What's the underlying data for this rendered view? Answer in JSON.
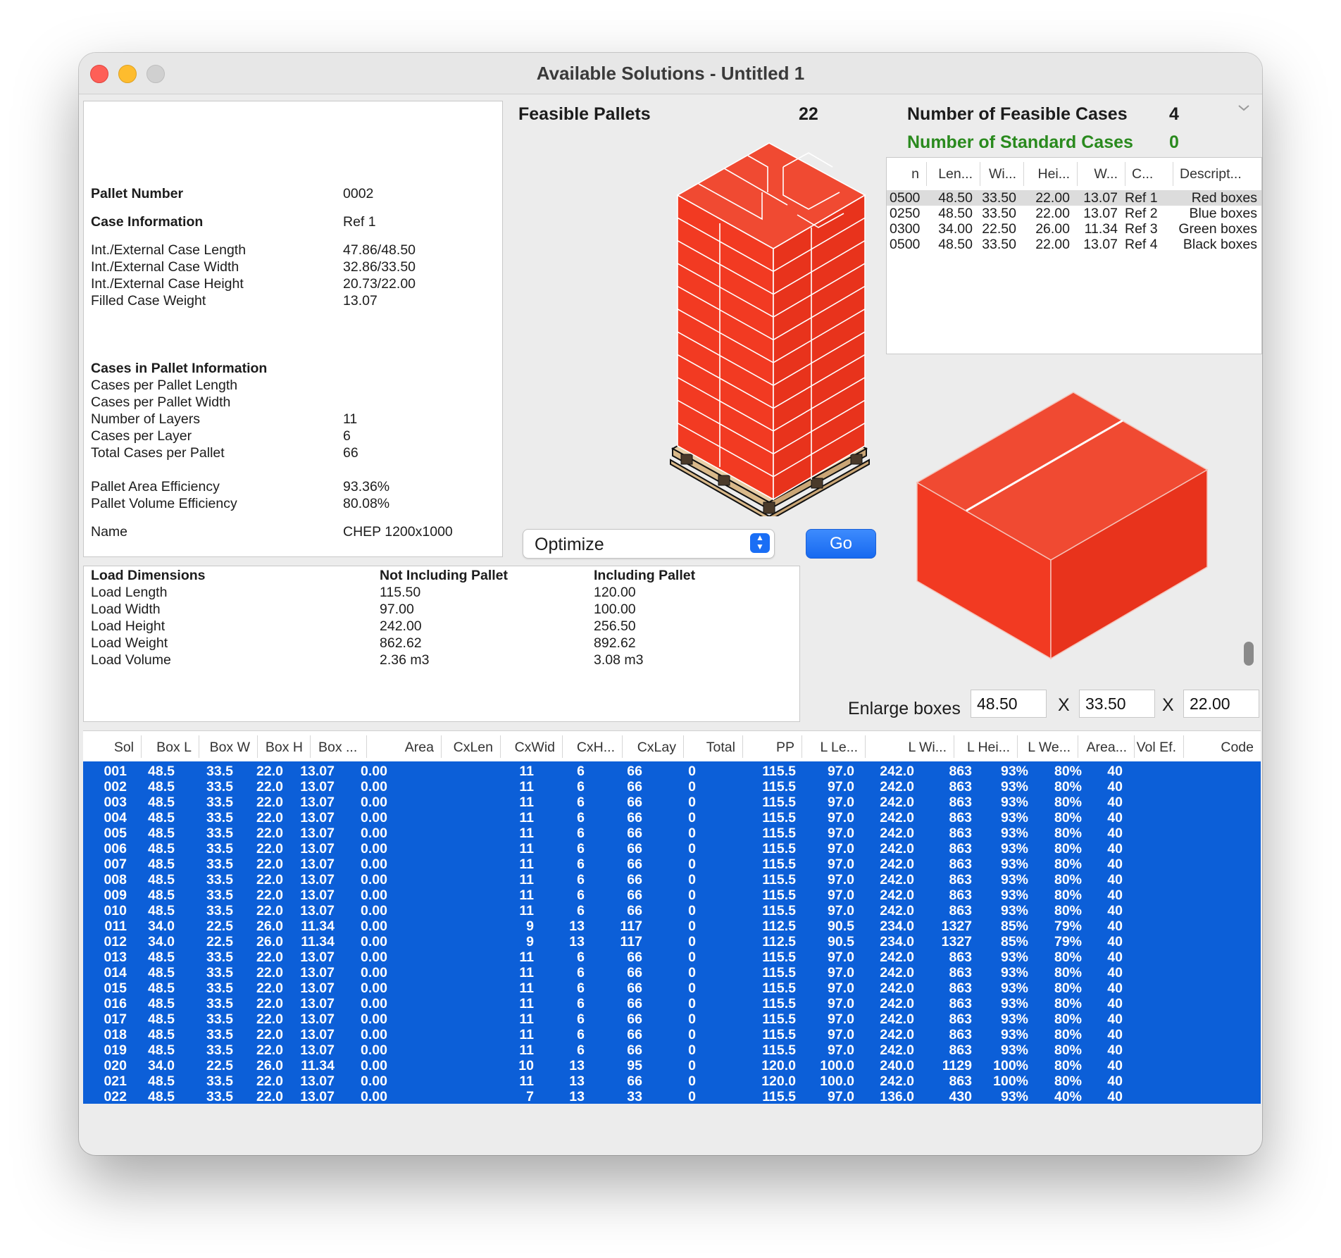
{
  "window": {
    "title": "Available Solutions - Untitled 1"
  },
  "pallet_info": {
    "pallet_number_label": "Pallet Number",
    "pallet_number": "0002",
    "case_info_label": "Case Information",
    "case_info": "Ref 1",
    "rows": [
      {
        "label": "Int./External Case Length",
        "value": "47.86/48.50"
      },
      {
        "label": "Int./External Case Width",
        "value": "32.86/33.50"
      },
      {
        "label": "Int./External Case Height",
        "value": "20.73/22.00"
      },
      {
        "label": "Filled Case Weight",
        "value": "13.07"
      }
    ],
    "cases_in_pallet_label": "Cases in Pallet Information",
    "rows2": [
      {
        "label": "Cases per Pallet Length",
        "value": ""
      },
      {
        "label": "Cases per Pallet Width",
        "value": ""
      },
      {
        "label": "Number of Layers",
        "value": "11"
      },
      {
        "label": "Cases per Layer",
        "value": "6"
      },
      {
        "label": "Total Cases per Pallet",
        "value": "66"
      }
    ],
    "rows3": [
      {
        "label": "Pallet Area Efficiency",
        "value": "93.36%"
      },
      {
        "label": "Pallet Volume Efficiency",
        "value": "80.08%"
      }
    ],
    "name_label": "Name",
    "name": "CHEP 1200x1000"
  },
  "load": {
    "headers": [
      "Load Dimensions",
      "Not Including Pallet",
      "Including Pallet"
    ],
    "rows": [
      [
        "Load Length",
        "115.50",
        "120.00"
      ],
      [
        "Load Width",
        "97.00",
        "100.00"
      ],
      [
        "Load Height",
        "242.00",
        "256.50"
      ],
      [
        "Load Weight",
        "862.62",
        "892.62"
      ],
      [
        "Load Volume",
        "2.36 m3",
        "3.08 m3"
      ]
    ]
  },
  "feasible": {
    "pallets_label": "Feasible Pallets",
    "pallets_count": "22",
    "cases_label": "Number of Feasible Cases",
    "cases_count": "4",
    "standard_label": "Number of Standard Cases",
    "standard_count": "0"
  },
  "cases_table": {
    "headers": [
      "n",
      "Len...",
      "Wi...",
      "Hei...",
      "W...",
      "C...",
      "Descript..."
    ],
    "rows": [
      [
        "0500",
        "48.50",
        "33.50",
        "22.00",
        "13.07",
        "Ref 1",
        "Red boxes"
      ],
      [
        "0250",
        "48.50",
        "33.50",
        "22.00",
        "13.07",
        "Ref 2",
        "Blue boxes"
      ],
      [
        "0300",
        "34.00",
        "22.50",
        "26.00",
        "11.34",
        "Ref 3",
        "Green boxes"
      ],
      [
        "0500",
        "48.50",
        "33.50",
        "22.00",
        "13.07",
        "Ref 4",
        "Black boxes"
      ]
    ]
  },
  "controls": {
    "optimize": "Optimize",
    "go": "Go",
    "enlarge_label": "Enlarge boxes",
    "x": "X",
    "enlarge_l": "48.50",
    "enlarge_w": "33.50",
    "enlarge_h": "22.00"
  },
  "colors": {
    "box": "#f23a22",
    "selection": "#0c5fd8",
    "accent": "#1a6ef5",
    "green": "#2a8a1e"
  },
  "solutions": {
    "headers": [
      "Sol",
      "Box L",
      "Box W",
      "Box H",
      "Box ...",
      "Area",
      "CxLen",
      "CxWid",
      "CxH...",
      "CxLay",
      "Total",
      "PP",
      "L Le...",
      "L Wi...",
      "L Hei...",
      "L We...",
      "Area...",
      "Vol Ef.",
      "Code"
    ],
    "rows": [
      [
        "001",
        "48.5",
        "33.5",
        "22.0",
        "13.07",
        "0.00",
        "",
        "",
        "11",
        "6",
        "66",
        "0",
        "115.5",
        "97.0",
        "242.0",
        "863",
        "93%",
        "80%",
        "40"
      ],
      [
        "002",
        "48.5",
        "33.5",
        "22.0",
        "13.07",
        "0.00",
        "",
        "",
        "11",
        "6",
        "66",
        "0",
        "115.5",
        "97.0",
        "242.0",
        "863",
        "93%",
        "80%",
        "40"
      ],
      [
        "003",
        "48.5",
        "33.5",
        "22.0",
        "13.07",
        "0.00",
        "",
        "",
        "11",
        "6",
        "66",
        "0",
        "115.5",
        "97.0",
        "242.0",
        "863",
        "93%",
        "80%",
        "40"
      ],
      [
        "004",
        "48.5",
        "33.5",
        "22.0",
        "13.07",
        "0.00",
        "",
        "",
        "11",
        "6",
        "66",
        "0",
        "115.5",
        "97.0",
        "242.0",
        "863",
        "93%",
        "80%",
        "40"
      ],
      [
        "005",
        "48.5",
        "33.5",
        "22.0",
        "13.07",
        "0.00",
        "",
        "",
        "11",
        "6",
        "66",
        "0",
        "115.5",
        "97.0",
        "242.0",
        "863",
        "93%",
        "80%",
        "40"
      ],
      [
        "006",
        "48.5",
        "33.5",
        "22.0",
        "13.07",
        "0.00",
        "",
        "",
        "11",
        "6",
        "66",
        "0",
        "115.5",
        "97.0",
        "242.0",
        "863",
        "93%",
        "80%",
        "40"
      ],
      [
        "007",
        "48.5",
        "33.5",
        "22.0",
        "13.07",
        "0.00",
        "",
        "",
        "11",
        "6",
        "66",
        "0",
        "115.5",
        "97.0",
        "242.0",
        "863",
        "93%",
        "80%",
        "40"
      ],
      [
        "008",
        "48.5",
        "33.5",
        "22.0",
        "13.07",
        "0.00",
        "",
        "",
        "11",
        "6",
        "66",
        "0",
        "115.5",
        "97.0",
        "242.0",
        "863",
        "93%",
        "80%",
        "40"
      ],
      [
        "009",
        "48.5",
        "33.5",
        "22.0",
        "13.07",
        "0.00",
        "",
        "",
        "11",
        "6",
        "66",
        "0",
        "115.5",
        "97.0",
        "242.0",
        "863",
        "93%",
        "80%",
        "40"
      ],
      [
        "010",
        "48.5",
        "33.5",
        "22.0",
        "13.07",
        "0.00",
        "",
        "",
        "11",
        "6",
        "66",
        "0",
        "115.5",
        "97.0",
        "242.0",
        "863",
        "93%",
        "80%",
        "40"
      ],
      [
        "011",
        "34.0",
        "22.5",
        "26.0",
        "11.34",
        "0.00",
        "",
        "",
        "9",
        "13",
        "117",
        "0",
        "112.5",
        "90.5",
        "234.0",
        "1327",
        "85%",
        "79%",
        "40"
      ],
      [
        "012",
        "34.0",
        "22.5",
        "26.0",
        "11.34",
        "0.00",
        "",
        "",
        "9",
        "13",
        "117",
        "0",
        "112.5",
        "90.5",
        "234.0",
        "1327",
        "85%",
        "79%",
        "40"
      ],
      [
        "013",
        "48.5",
        "33.5",
        "22.0",
        "13.07",
        "0.00",
        "",
        "",
        "11",
        "6",
        "66",
        "0",
        "115.5",
        "97.0",
        "242.0",
        "863",
        "93%",
        "80%",
        "40"
      ],
      [
        "014",
        "48.5",
        "33.5",
        "22.0",
        "13.07",
        "0.00",
        "",
        "",
        "11",
        "6",
        "66",
        "0",
        "115.5",
        "97.0",
        "242.0",
        "863",
        "93%",
        "80%",
        "40"
      ],
      [
        "015",
        "48.5",
        "33.5",
        "22.0",
        "13.07",
        "0.00",
        "",
        "",
        "11",
        "6",
        "66",
        "0",
        "115.5",
        "97.0",
        "242.0",
        "863",
        "93%",
        "80%",
        "40"
      ],
      [
        "016",
        "48.5",
        "33.5",
        "22.0",
        "13.07",
        "0.00",
        "",
        "",
        "11",
        "6",
        "66",
        "0",
        "115.5",
        "97.0",
        "242.0",
        "863",
        "93%",
        "80%",
        "40"
      ],
      [
        "017",
        "48.5",
        "33.5",
        "22.0",
        "13.07",
        "0.00",
        "",
        "",
        "11",
        "6",
        "66",
        "0",
        "115.5",
        "97.0",
        "242.0",
        "863",
        "93%",
        "80%",
        "40"
      ],
      [
        "018",
        "48.5",
        "33.5",
        "22.0",
        "13.07",
        "0.00",
        "",
        "",
        "11",
        "6",
        "66",
        "0",
        "115.5",
        "97.0",
        "242.0",
        "863",
        "93%",
        "80%",
        "40"
      ],
      [
        "019",
        "48.5",
        "33.5",
        "22.0",
        "13.07",
        "0.00",
        "",
        "",
        "11",
        "6",
        "66",
        "0",
        "115.5",
        "97.0",
        "242.0",
        "863",
        "93%",
        "80%",
        "40"
      ],
      [
        "020",
        "34.0",
        "22.5",
        "26.0",
        "11.34",
        "0.00",
        "",
        "",
        "10",
        "13",
        "95",
        "0",
        "120.0",
        "100.0",
        "240.0",
        "1129",
        "100%",
        "80%",
        "40"
      ],
      [
        "021",
        "48.5",
        "33.5",
        "22.0",
        "13.07",
        "0.00",
        "",
        "",
        "11",
        "13",
        "66",
        "0",
        "120.0",
        "100.0",
        "242.0",
        "863",
        "100%",
        "80%",
        "40"
      ],
      [
        "022",
        "48.5",
        "33.5",
        "22.0",
        "13.07",
        "0.00",
        "",
        "",
        "7",
        "13",
        "33",
        "0",
        "115.5",
        "97.0",
        "136.0",
        "430",
        "93%",
        "40%",
        "40"
      ]
    ]
  }
}
